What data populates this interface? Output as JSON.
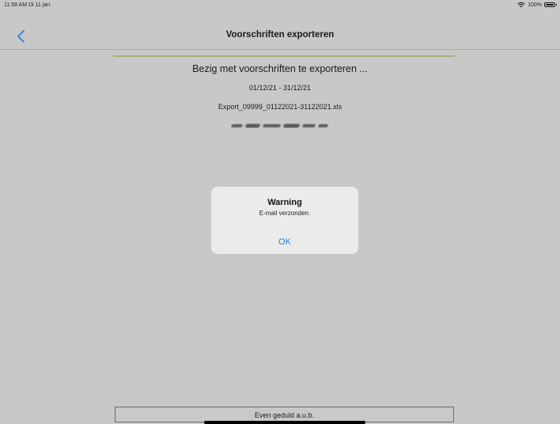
{
  "status_bar": {
    "time": "11:58 AM  Di 11 jan.",
    "battery": "100%",
    "icons": [
      "wifi-icon",
      "battery-icon"
    ]
  },
  "nav": {
    "title": "Voorschriften exporteren",
    "back_icon": "chevron-left-icon"
  },
  "export": {
    "progress": 1.0,
    "status": "Bezig met voorschriften te exporteren ...",
    "date_range": "01/12/21 - 31/12/21",
    "file_name": "Export_09999_01122021-31122021.xls"
  },
  "alert": {
    "title": "Warning",
    "message": "E-mail verzonden.",
    "ok_label": "OK"
  },
  "footer": {
    "wait_label": "Even geduld a.u.b."
  },
  "colors": {
    "background": "#c8c8c8",
    "accent": "#2a7fd6",
    "progress": "#a8b07a"
  }
}
